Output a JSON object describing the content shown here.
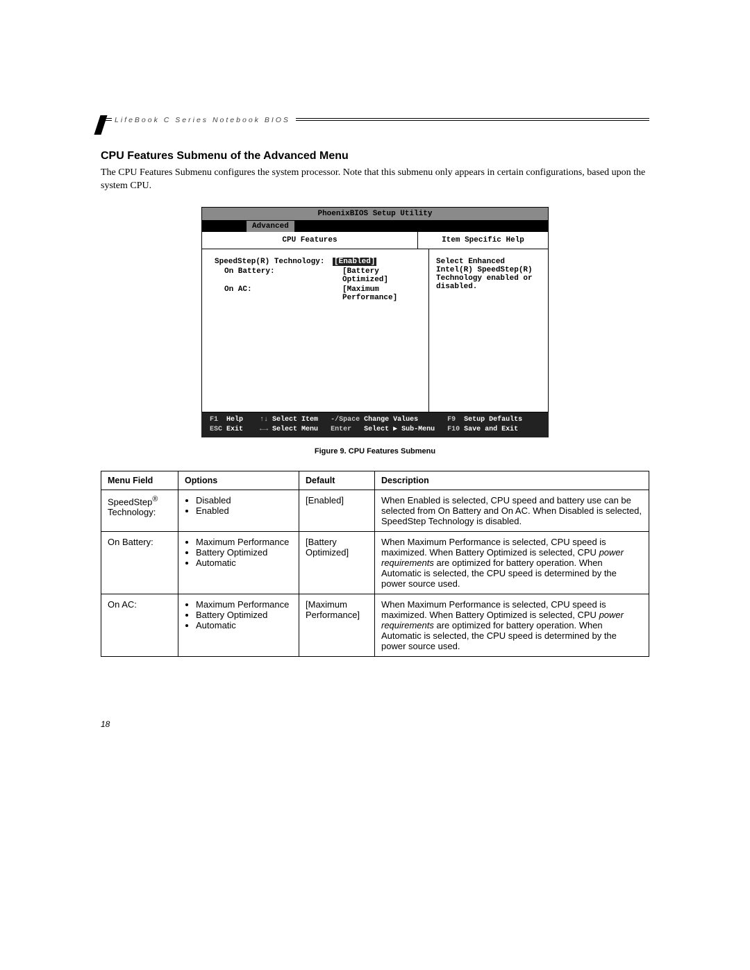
{
  "header": {
    "running": "LifeBook C Series Notebook BIOS"
  },
  "section": {
    "heading": "CPU Features Submenu of the Advanced Menu",
    "body": "The CPU Features Submenu configures the system processor. Note that this submenu only appears in certain configurations, based upon the system CPU."
  },
  "bios": {
    "title": "PhoenixBIOS Setup Utility",
    "tab": "Advanced",
    "left_header": "CPU Features",
    "right_header": "Item Specific Help",
    "rows": [
      {
        "label": "SpeedStep(R) Technology:",
        "value": "[Enabled]",
        "indent": false,
        "selected": true
      },
      {
        "label": "On Battery:",
        "value": "[Battery Optimized]",
        "indent": true,
        "selected": false
      },
      {
        "label": "On AC:",
        "value": "[Maximum Performance]",
        "indent": true,
        "selected": false
      }
    ],
    "help": "Select Enhanced Intel(R) SpeedStep(R) Technology enabled or disabled.",
    "footer": {
      "f1": "F1",
      "help": "Help",
      "updn": "↑↓",
      "selitem": "Select Item",
      "space_k": "-/Space",
      "space_v": "Change Values",
      "f9": "F9",
      "setup": "Setup Defaults",
      "esc": "ESC",
      "exit": "Exit",
      "lr": "←→",
      "selmenu": "Select Menu",
      "enter_k": "Enter",
      "enter_v": "Select ▶ Sub-Menu",
      "f10": "F10",
      "save": "Save and Exit"
    }
  },
  "caption": "Figure 9.  CPU Features Submenu",
  "table": {
    "headers": {
      "c1": "Menu Field",
      "c2": "Options",
      "c3": "Default",
      "c4": "Description"
    },
    "rows": [
      {
        "field_html": "SpeedStep<sup>®</sup> Technology:",
        "options": [
          "Disabled",
          "Enabled"
        ],
        "default": "[Enabled]",
        "desc_pre": "When Enabled is selected, CPU speed and battery use can be selected from On Battery and On AC. When Disabled is selected, SpeedStep Technology is disabled.",
        "desc_ital": "",
        "desc_post": ""
      },
      {
        "field_html": "On Battery:",
        "options": [
          "Maximum Performance",
          "Battery Optimized",
          "Automatic"
        ],
        "default": "[Battery Optimized]",
        "desc_pre": "When Maximum Performance is selected, CPU speed is maximized. When Battery Optimized is selected, CPU ",
        "desc_ital": "power requirements",
        "desc_post": " are optimized for battery operation. When Automatic is selected, the CPU speed is determined by the power source used."
      },
      {
        "field_html": "On AC:",
        "options": [
          "Maximum Performance",
          "Battery Optimized",
          "Automatic"
        ],
        "default": "[Maximum Performance]",
        "desc_pre": "When Maximum Performance is selected, CPU speed is maximized. When Battery Optimized is selected, CPU ",
        "desc_ital": "power requirements",
        "desc_post": " are optimized for battery operation. When Automatic is selected, the CPU speed is determined by the power source used."
      }
    ]
  },
  "page_number": "18"
}
